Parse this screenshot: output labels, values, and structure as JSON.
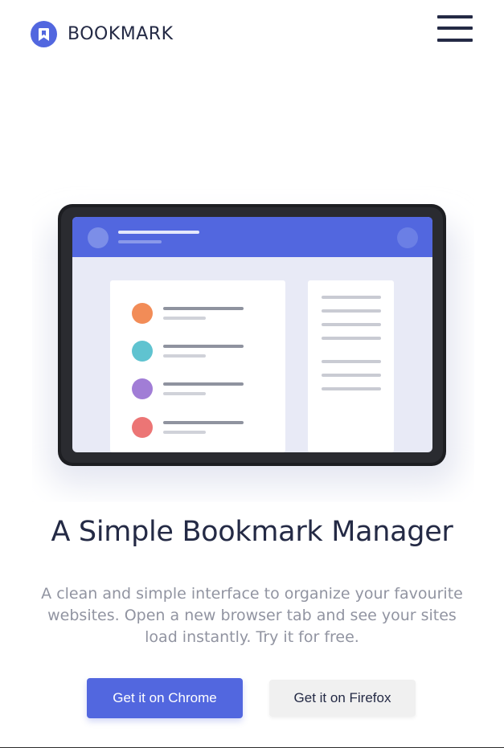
{
  "header": {
    "brand_name": "BOOKMARK",
    "logo_icon": "bookmark-icon",
    "menu_icon": "hamburger-menu-icon"
  },
  "hero": {
    "illustration": "tablet-bookmark-app-illustration",
    "list_dot_colors": [
      "#f28c57",
      "#5fc3d0",
      "#a17dd6",
      "#ec7575"
    ],
    "headline": "A Simple Bookmark Manager",
    "description": "A clean and simple interface to organize your favourite websites. Open a new browser tab and see your sites load instantly. Try it for free."
  },
  "cta": {
    "chrome_label": "Get it on Chrome",
    "firefox_label": "Get it on Firefox"
  },
  "colors": {
    "accent": "#5267df",
    "heading": "#242a45",
    "body_text": "#9194a1",
    "secondary_button": "#f0f0f0"
  }
}
